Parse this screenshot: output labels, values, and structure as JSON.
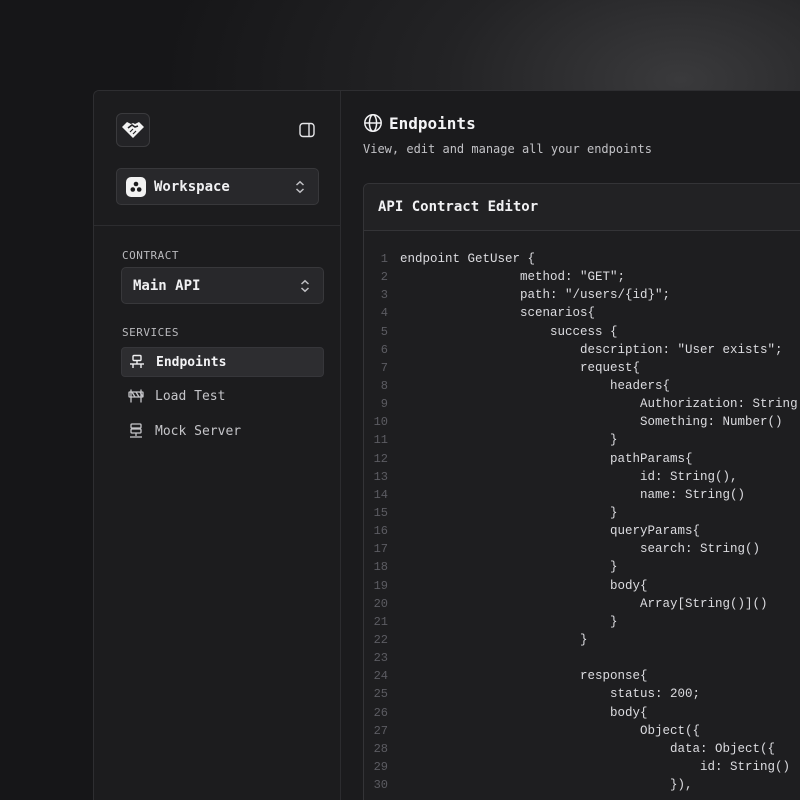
{
  "workspace": {
    "label": "Workspace"
  },
  "contract": {
    "section_label": "CONTRACT",
    "selected": "Main API"
  },
  "services": {
    "section_label": "SERVICES",
    "items": [
      {
        "label": "Endpoints",
        "icon": "network-icon",
        "active": true
      },
      {
        "label": "Load Test",
        "icon": "barrier-icon",
        "active": false
      },
      {
        "label": "Mock Server",
        "icon": "server-icon",
        "active": false
      }
    ]
  },
  "page": {
    "title": "Endpoints",
    "subtitle": "View, edit and manage all your endpoints"
  },
  "editor": {
    "title": "API Contract Editor",
    "lines": [
      "endpoint GetUser {",
      "                method: \"GET\";",
      "                path: \"/users/{id}\";",
      "                scenarios{",
      "                    success {",
      "                        description: \"User exists\";",
      "                        request{",
      "                            headers{",
      "                                Authorization: String",
      "                                Something: Number()",
      "                            }",
      "                            pathParams{",
      "                                id: String(),",
      "                                name: String()",
      "                            }",
      "                            queryParams{",
      "                                search: String()",
      "                            }",
      "                            body{",
      "                                Array[String()]()",
      "                            }",
      "                        }",
      "",
      "                        response{",
      "                            status: 200;",
      "                            body{",
      "                                Object({",
      "                                    data: Object({",
      "                                        id: String()",
      "                                    }),"
    ]
  }
}
